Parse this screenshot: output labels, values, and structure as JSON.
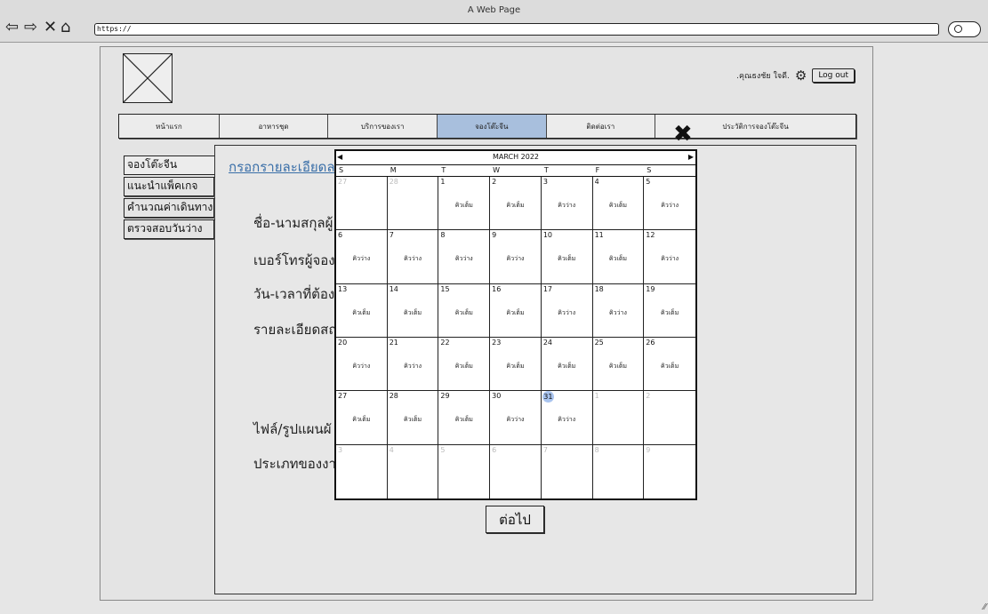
{
  "window": {
    "title": "A Web Page",
    "url": "https://"
  },
  "nav_icons": [
    "back-arrow-icon",
    "forward-arrow-icon",
    "close-icon",
    "home-icon",
    "search-icon"
  ],
  "header": {
    "user_name": ".คุณธงชัย ใจดี.",
    "logout_label": "Log out"
  },
  "menu": {
    "items": [
      {
        "label": "หน้าแรก"
      },
      {
        "label": "อาหารชุด"
      },
      {
        "label": "บริการของเรา"
      },
      {
        "label": "จองโต๊ะจีน"
      },
      {
        "label": "ติดต่อเรา"
      },
      {
        "label": "ประวัติการจองโต๊ะจีน"
      }
    ],
    "active_index": 3
  },
  "side_nav": {
    "items": [
      {
        "label": "จองโต๊ะจีน"
      },
      {
        "label": "แนะนำแพ็คเกจ"
      },
      {
        "label": "คำนวณค่าเดินทาง"
      },
      {
        "label": "ตรวจสอบวันว่าง"
      }
    ],
    "active_index": 0
  },
  "form": {
    "heading": "กรอกรายละเอียดล",
    "labels": {
      "name": "ชื่อ-นามสกุลผู้",
      "phone": "เบอร์โทรผู้จอง",
      "datetime": "วัน-เวลาที่ต้อง",
      "details": "รายละเอียดสถ",
      "file": "ไฟล์/รูปแผนผั",
      "type": "ประเภทของงา"
    },
    "next_label": "ต่อไป"
  },
  "calendar": {
    "month_label": "MARCH 2022",
    "prev_glyph": "◀",
    "next_glyph": "▶",
    "weekdays": [
      "S",
      "M",
      "T",
      "W",
      "T",
      "F",
      "S"
    ],
    "weeks": [
      [
        {
          "day": "27",
          "muted": true,
          "status": ""
        },
        {
          "day": "28",
          "muted": true,
          "status": ""
        },
        {
          "day": "1",
          "status": "คิวเต็ม"
        },
        {
          "day": "2",
          "status": "คิวเต็ม"
        },
        {
          "day": "3",
          "status": "คิวว่าง"
        },
        {
          "day": "4",
          "status": "คิวเต็ม"
        },
        {
          "day": "5",
          "status": "คิวว่าง"
        }
      ],
      [
        {
          "day": "6",
          "status": "คิวว่าง"
        },
        {
          "day": "7",
          "status": "คิวว่าง"
        },
        {
          "day": "8",
          "status": "คิวว่าง"
        },
        {
          "day": "9",
          "status": "คิวว่าง"
        },
        {
          "day": "10",
          "status": "คิวเต็ม"
        },
        {
          "day": "11",
          "status": "คิวเต็ม"
        },
        {
          "day": "12",
          "status": "คิวว่าง"
        }
      ],
      [
        {
          "day": "13",
          "status": "คิวเต็ม"
        },
        {
          "day": "14",
          "status": "คิวเต็ม"
        },
        {
          "day": "15",
          "status": "คิวเต็ม"
        },
        {
          "day": "16",
          "status": "คิวเต็ม"
        },
        {
          "day": "17",
          "status": "คิวว่าง"
        },
        {
          "day": "18",
          "status": "คิวว่าง"
        },
        {
          "day": "19",
          "status": "คิวเต็ม"
        }
      ],
      [
        {
          "day": "20",
          "status": "คิวว่าง"
        },
        {
          "day": "21",
          "status": "คิวว่าง"
        },
        {
          "day": "22",
          "status": "คิวเต็ม"
        },
        {
          "day": "23",
          "status": "คิวเต็ม"
        },
        {
          "day": "24",
          "status": "คิวเต็ม"
        },
        {
          "day": "25",
          "status": "คิวเต็ม"
        },
        {
          "day": "26",
          "status": "คิวเต็ม"
        }
      ],
      [
        {
          "day": "27",
          "status": "คิวเต็ม"
        },
        {
          "day": "28",
          "status": "คิวเต็ม"
        },
        {
          "day": "29",
          "status": "คิวเต็ม"
        },
        {
          "day": "30",
          "status": "คิวว่าง"
        },
        {
          "day": "31",
          "status": "คิวว่าง",
          "today": true
        },
        {
          "day": "1",
          "muted": true,
          "status": ""
        },
        {
          "day": "2",
          "muted": true,
          "status": ""
        }
      ],
      [
        {
          "day": "3",
          "muted": true,
          "status": ""
        },
        {
          "day": "4",
          "muted": true,
          "status": ""
        },
        {
          "day": "5",
          "muted": true,
          "status": ""
        },
        {
          "day": "6",
          "muted": true,
          "status": ""
        },
        {
          "day": "7",
          "muted": true,
          "status": ""
        },
        {
          "day": "8",
          "muted": true,
          "status": ""
        },
        {
          "day": "9",
          "muted": true,
          "status": ""
        }
      ]
    ]
  },
  "colors": {
    "active_tab": "#a8bfdd",
    "link": "#3a6fa8",
    "today_highlight": "#a9c4ef"
  }
}
